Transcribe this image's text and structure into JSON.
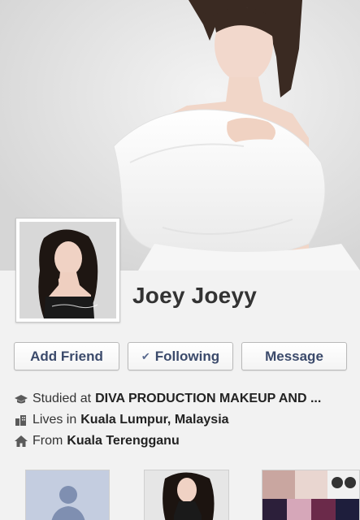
{
  "profile": {
    "name": "Joey Joeyy"
  },
  "actions": {
    "add_friend": "Add Friend",
    "following": "Following",
    "following_check": "✔",
    "message": "Message"
  },
  "about": {
    "studied_prefix": "Studied at",
    "studied_value": "DIVA PRODUCTION MAKEUP AND ...",
    "lives_prefix": "Lives in",
    "lives_value": "Kuala Lumpur, Malaysia",
    "from_prefix": "From",
    "from_value": "Kuala Terengganu"
  },
  "icons": {
    "education": "graduation-cap-icon",
    "city": "building-icon",
    "hometown": "house-icon",
    "placeholder_friend": "person-silhouette-icon"
  },
  "colors": {
    "button_text": "#3b4a6b",
    "icon_gray": "#5a5a5a",
    "friend_placeholder": "#c4cde0"
  }
}
